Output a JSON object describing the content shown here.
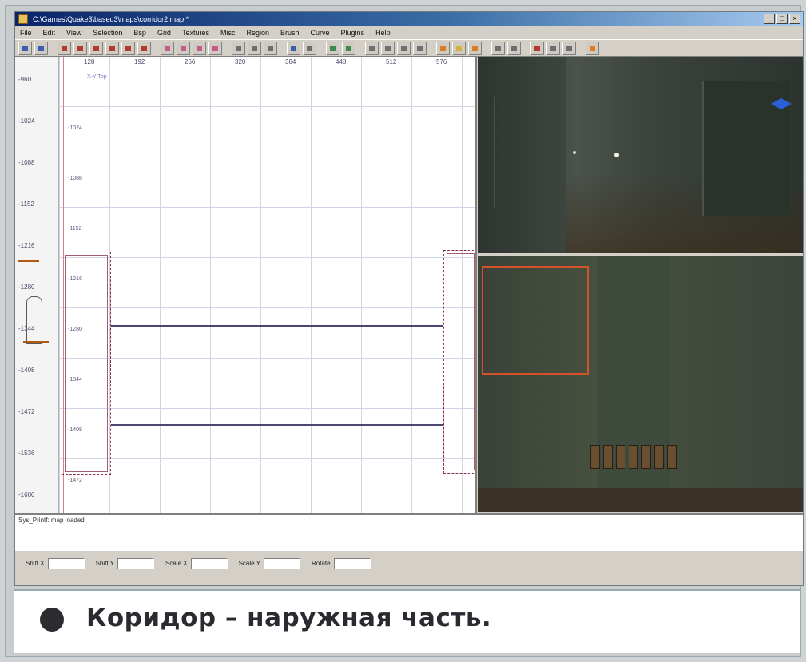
{
  "window": {
    "title": "C:\\Games\\Quake3\\baseq3\\maps\\corridor2.map *",
    "buttons": [
      "_",
      "□",
      "×"
    ]
  },
  "menubar": {
    "items": [
      "File",
      "Edit",
      "View",
      "Selection",
      "Bsp",
      "Grid",
      "Textures",
      "Misc",
      "Region",
      "Brush",
      "Curve",
      "Plugins",
      "Help"
    ]
  },
  "toolbar": {
    "tools": [
      {
        "name": "open-icon",
        "color": "blue"
      },
      {
        "name": "save-icon",
        "color": "blue"
      },
      {
        "name": "sep"
      },
      {
        "name": "flip-x-icon",
        "color": "red"
      },
      {
        "name": "flip-y-icon",
        "color": "red"
      },
      {
        "name": "flip-z-icon",
        "color": "red"
      },
      {
        "name": "rotate-x-icon",
        "color": "red"
      },
      {
        "name": "rotate-y-icon",
        "color": "red"
      },
      {
        "name": "rotate-z-icon",
        "color": "red"
      },
      {
        "name": "sep"
      },
      {
        "name": "select-complete-icon",
        "color": "pink"
      },
      {
        "name": "select-touching-icon",
        "color": "pink"
      },
      {
        "name": "select-partial-icon",
        "color": "pink"
      },
      {
        "name": "select-inside-icon",
        "color": "pink"
      },
      {
        "name": "sep"
      },
      {
        "name": "csg-subtract-icon",
        "color": "grey"
      },
      {
        "name": "csg-merge-icon",
        "color": "grey"
      },
      {
        "name": "hollow-icon",
        "color": "grey"
      },
      {
        "name": "sep"
      },
      {
        "name": "change-views-icon",
        "color": "blue"
      },
      {
        "name": "texture-view-icon",
        "color": "grey"
      },
      {
        "name": "sep"
      },
      {
        "name": "clipper-icon",
        "color": "green"
      },
      {
        "name": "camera-icon",
        "color": "green"
      },
      {
        "name": "sep"
      },
      {
        "name": "patch-icon",
        "color": "grey"
      },
      {
        "name": "patch-bend-icon",
        "color": "grey"
      },
      {
        "name": "patch-insert-icon",
        "color": "grey"
      },
      {
        "name": "patch-delete-icon",
        "color": "grey"
      },
      {
        "name": "sep"
      },
      {
        "name": "entity-icon",
        "color": "orange"
      },
      {
        "name": "light-icon",
        "color": "yellow"
      },
      {
        "name": "model-icon",
        "color": "orange"
      },
      {
        "name": "sep"
      },
      {
        "name": "scale-icon",
        "color": "grey"
      },
      {
        "name": "drag-edges-icon",
        "color": "grey"
      },
      {
        "name": "sep"
      },
      {
        "name": "show-entities-icon",
        "color": "red"
      },
      {
        "name": "select-arrow-icon",
        "color": "grey"
      },
      {
        "name": "pointer-icon",
        "color": "grey"
      },
      {
        "name": "sep"
      },
      {
        "name": "stop-icon",
        "color": "orange"
      }
    ]
  },
  "grid_view": {
    "top_ticks": [
      "128",
      "192",
      "256",
      "320",
      "384",
      "448",
      "512",
      "576"
    ],
    "left_ticks": [
      "-960",
      "-1024",
      "-1088",
      "-1152",
      "-1216",
      "-1280",
      "-1344",
      "-1408",
      "-1472",
      "-1536",
      "-1600"
    ],
    "inner_ticks": [
      "-1024",
      "-1088",
      "-1152",
      "-1216",
      "-1280",
      "-1344",
      "-1408",
      "-1472"
    ],
    "view_label": "X-Y Top"
  },
  "console": {
    "text": "Sys_Printf: map loaded"
  },
  "statusbar": {
    "fields": [
      {
        "label": "Shift X"
      },
      {
        "label": "Shift Y"
      },
      {
        "label": "Scale X"
      },
      {
        "label": "Scale Y"
      },
      {
        "label": "Rotate"
      }
    ]
  },
  "caption": {
    "text": "Коридор – наружная часть."
  }
}
